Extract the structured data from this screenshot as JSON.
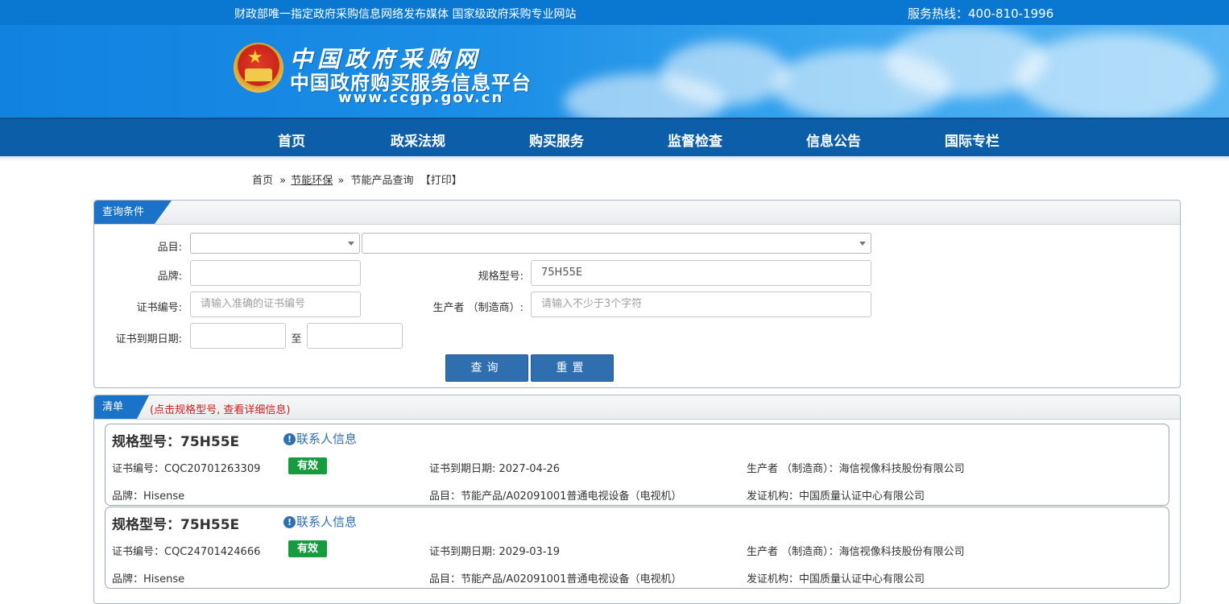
{
  "topbar": {
    "slogan": "财政部唯一指定政府采购信息网络发布媒体 国家级政府采购专业网站",
    "hotline": "服务热线：400-810-1996"
  },
  "banner": {
    "name_cn": "中国政府采购网",
    "platform": "中国政府购买服务信息平台",
    "url": "www.ccgp.gov.cn"
  },
  "nav": [
    "首页",
    "政采法规",
    "购买服务",
    "监督检查",
    "信息公告",
    "国际专栏"
  ],
  "breadcrumb": {
    "home": "首页",
    "sep": "»",
    "section": "节能环保",
    "page": "节能产品查询",
    "print": "【打印】"
  },
  "query": {
    "tab": "查询条件",
    "category_label": "品目:",
    "brand_label": "品牌:",
    "brand_value": "",
    "model_label": "规格型号:",
    "model_value": "75H55E",
    "cert_label": "证书编号:",
    "cert_placeholder": "请输入准确的证书编号",
    "maker_label": "生产者 （制造商）:",
    "maker_placeholder": "请输入不少于3个字符",
    "expiry_label": "证书到期日期:",
    "to_label": "至",
    "search_btn": "查询",
    "reset_btn": "重置"
  },
  "list": {
    "tab": "清单",
    "note": "(点击规格型号, 查看详细信息)",
    "contact_label": "联系人信息",
    "items": [
      {
        "model": "规格型号：75H55E",
        "cert": "证书编号：CQC20701263309",
        "status": "有效",
        "expiry": "证书到期日期: 2027-04-26",
        "maker": "生产者 （制造商）：海信视像科技股份有限公司",
        "brand": "品牌：Hisense",
        "category": "品目：节能产品/A02091001普通电视设备（电视机）",
        "issuer": "发证机构：中国质量认证中心有限公司"
      },
      {
        "model": "规格型号：75H55E",
        "cert": "证书编号：CQC24701424666",
        "status": "有效",
        "expiry": "证书到期日期: 2029-03-19",
        "maker": "生产者 （制造商）：海信视像科技股份有限公司",
        "brand": "品牌：Hisense",
        "category": "品目：节能产品/A02091001普通电视设备（电视机）",
        "issuer": "发证机构：中国质量认证中心有限公司"
      }
    ]
  },
  "colors": {
    "primary": "#1a73c7",
    "nav": "#0d5ea8",
    "valid": "#179b3f",
    "note": "#cc1f1f"
  }
}
